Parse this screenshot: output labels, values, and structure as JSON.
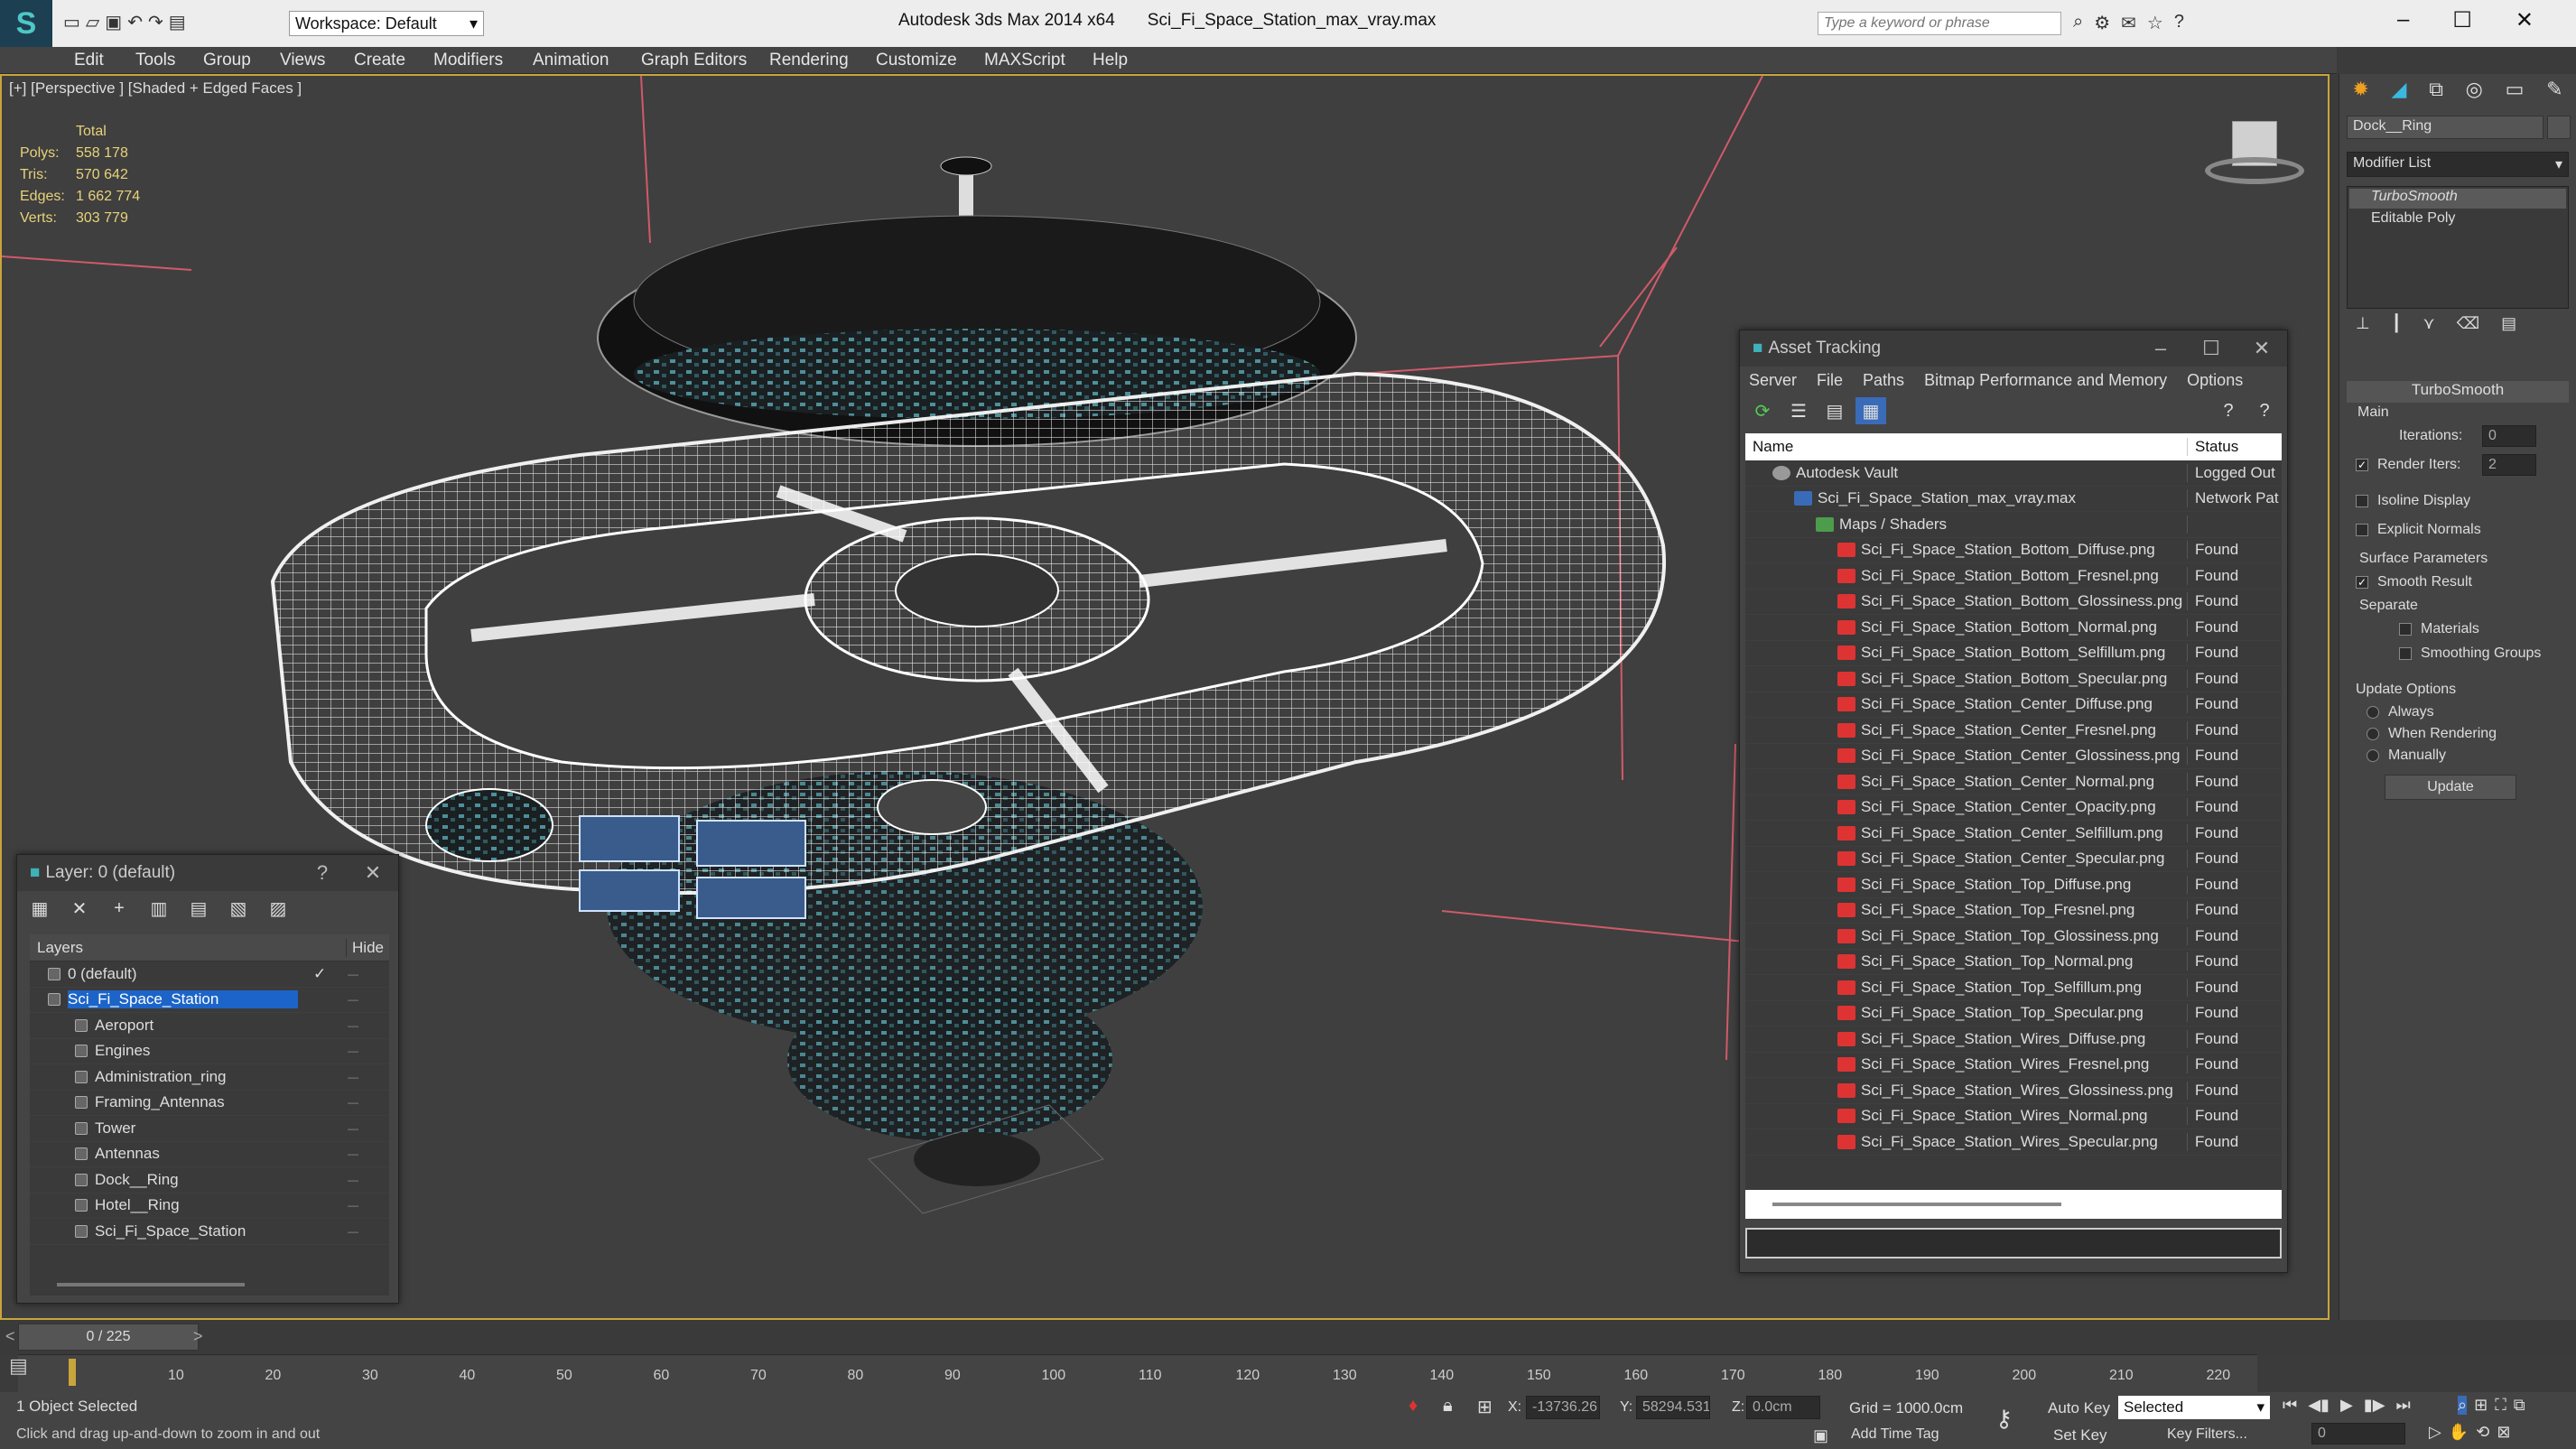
{
  "app": {
    "title": "Autodesk 3ds Max  2014 x64",
    "file": "Sci_Fi_Space_Station_max_vray.max",
    "workspace": "Workspace: Default",
    "search_placeholder": "Type a keyword or phrase"
  },
  "menu": [
    "Edit",
    "Tools",
    "Group",
    "Views",
    "Create",
    "Modifiers",
    "Animation",
    "Graph Editors",
    "Rendering",
    "Customize",
    "MAXScript",
    "Help"
  ],
  "viewport": {
    "label": "[+] [Perspective ] [Shaded + Edged Faces ]",
    "stats": {
      "total_label": "Total",
      "polys_label": "Polys:",
      "polys": "558 178",
      "tris_label": "Tris:",
      "tris": "570 642",
      "edges_label": "Edges:",
      "edges": "1 662 774",
      "verts_label": "Verts:",
      "verts": "303 779"
    }
  },
  "layer_window": {
    "title": "Layer: 0 (default)",
    "help": "?",
    "col_layers": "Layers",
    "col_hide": "Hide",
    "rows": [
      {
        "name": "0 (default)",
        "level": 0
      },
      {
        "name": "Sci_Fi_Space_Station",
        "level": 0,
        "selected": true
      },
      {
        "name": "Aeroport",
        "level": 1
      },
      {
        "name": "Engines",
        "level": 1
      },
      {
        "name": "Administration_ring",
        "level": 1
      },
      {
        "name": "Framing_Antennas",
        "level": 1
      },
      {
        "name": "Tower",
        "level": 1
      },
      {
        "name": "Antennas",
        "level": 1
      },
      {
        "name": "Dock__Ring",
        "level": 1
      },
      {
        "name": "Hotel__Ring",
        "level": 1
      },
      {
        "name": "Sci_Fi_Space_Station",
        "level": 1
      }
    ]
  },
  "asset_tracking": {
    "title": "Asset Tracking",
    "menu": [
      "Server",
      "File",
      "Paths",
      "Bitmap Performance and Memory",
      "Options"
    ],
    "col_name": "Name",
    "col_status": "Status",
    "rows": [
      {
        "name": "Autodesk Vault",
        "status": "Logged Out",
        "level": 0,
        "icon": "vault"
      },
      {
        "name": "Sci_Fi_Space_Station_max_vray.max",
        "status": "Network Pat",
        "level": 1,
        "icon": "max"
      },
      {
        "name": "Maps / Shaders",
        "status": "",
        "level": 2,
        "icon": "folder"
      },
      {
        "name": "Sci_Fi_Space_Station_Bottom_Diffuse.png",
        "status": "Found",
        "level": 3,
        "icon": "png"
      },
      {
        "name": "Sci_Fi_Space_Station_Bottom_Fresnel.png",
        "status": "Found",
        "level": 3,
        "icon": "png"
      },
      {
        "name": "Sci_Fi_Space_Station_Bottom_Glossiness.png",
        "status": "Found",
        "level": 3,
        "icon": "png"
      },
      {
        "name": "Sci_Fi_Space_Station_Bottom_Normal.png",
        "status": "Found",
        "level": 3,
        "icon": "png"
      },
      {
        "name": "Sci_Fi_Space_Station_Bottom_Selfillum.png",
        "status": "Found",
        "level": 3,
        "icon": "png"
      },
      {
        "name": "Sci_Fi_Space_Station_Bottom_Specular.png",
        "status": "Found",
        "level": 3,
        "icon": "png"
      },
      {
        "name": "Sci_Fi_Space_Station_Center_Diffuse.png",
        "status": "Found",
        "level": 3,
        "icon": "png"
      },
      {
        "name": "Sci_Fi_Space_Station_Center_Fresnel.png",
        "status": "Found",
        "level": 3,
        "icon": "png"
      },
      {
        "name": "Sci_Fi_Space_Station_Center_Glossiness.png",
        "status": "Found",
        "level": 3,
        "icon": "png"
      },
      {
        "name": "Sci_Fi_Space_Station_Center_Normal.png",
        "status": "Found",
        "level": 3,
        "icon": "png"
      },
      {
        "name": "Sci_Fi_Space_Station_Center_Opacity.png",
        "status": "Found",
        "level": 3,
        "icon": "png"
      },
      {
        "name": "Sci_Fi_Space_Station_Center_Selfillum.png",
        "status": "Found",
        "level": 3,
        "icon": "png"
      },
      {
        "name": "Sci_Fi_Space_Station_Center_Specular.png",
        "status": "Found",
        "level": 3,
        "icon": "png"
      },
      {
        "name": "Sci_Fi_Space_Station_Top_Diffuse.png",
        "status": "Found",
        "level": 3,
        "icon": "png"
      },
      {
        "name": "Sci_Fi_Space_Station_Top_Fresnel.png",
        "status": "Found",
        "level": 3,
        "icon": "png"
      },
      {
        "name": "Sci_Fi_Space_Station_Top_Glossiness.png",
        "status": "Found",
        "level": 3,
        "icon": "png"
      },
      {
        "name": "Sci_Fi_Space_Station_Top_Normal.png",
        "status": "Found",
        "level": 3,
        "icon": "png"
      },
      {
        "name": "Sci_Fi_Space_Station_Top_Selfillum.png",
        "status": "Found",
        "level": 3,
        "icon": "png"
      },
      {
        "name": "Sci_Fi_Space_Station_Top_Specular.png",
        "status": "Found",
        "level": 3,
        "icon": "png"
      },
      {
        "name": "Sci_Fi_Space_Station_Wires_Diffuse.png",
        "status": "Found",
        "level": 3,
        "icon": "png"
      },
      {
        "name": "Sci_Fi_Space_Station_Wires_Fresnel.png",
        "status": "Found",
        "level": 3,
        "icon": "png"
      },
      {
        "name": "Sci_Fi_Space_Station_Wires_Glossiness.png",
        "status": "Found",
        "level": 3,
        "icon": "png"
      },
      {
        "name": "Sci_Fi_Space_Station_Wires_Normal.png",
        "status": "Found",
        "level": 3,
        "icon": "png"
      },
      {
        "name": "Sci_Fi_Space_Station_Wires_Specular.png",
        "status": "Found",
        "level": 3,
        "icon": "png"
      }
    ]
  },
  "command_panel": {
    "object_name": "Dock__Ring",
    "modifier_list": "Modifier List",
    "stack": [
      "TurboSmooth",
      "Editable Poly"
    ],
    "rollout_title": "TurboSmooth",
    "main_label": "Main",
    "iterations_label": "Iterations:",
    "iterations": "0",
    "render_iters_label": "Render Iters:",
    "render_iters": "2",
    "render_iters_checked": true,
    "isoline_label": "Isoline Display",
    "explicit_normals_label": "Explicit Normals",
    "surface_params_label": "Surface Parameters",
    "smooth_result_label": "Smooth Result",
    "separate_label": "Separate",
    "materials_label": "Materials",
    "smoothing_groups_label": "Smoothing Groups",
    "update_options_label": "Update Options",
    "always_label": "Always",
    "when_rendering_label": "When Rendering",
    "manually_label": "Manually",
    "update_button": "Update"
  },
  "timeline": {
    "frame_label": "0 / 225",
    "ticks": [
      "10",
      "20",
      "30",
      "40",
      "50",
      "60",
      "70",
      "80",
      "90",
      "100",
      "110",
      "120",
      "130",
      "140",
      "150",
      "160",
      "170",
      "180",
      "190",
      "200",
      "210",
      "220"
    ]
  },
  "status": {
    "selection": "1 Object Selected",
    "prompt": "Click and drag up-and-down to zoom in and out",
    "x_label": "X:",
    "x": "-13736.26",
    "y_label": "Y:",
    "y": "58294.531",
    "z_label": "Z:",
    "z": "0.0cm",
    "grid": "Grid = 1000.0cm",
    "auto_key": "Auto Key",
    "set_key": "Set Key",
    "selected": "Selected",
    "key_filters": "Key Filters...",
    "add_time_tag": "Add Time Tag",
    "frame": "0"
  },
  "colors": {
    "accent": "#c8a53c",
    "selection": "#1c64c8",
    "stats": "#e8d27a",
    "png_icon": "#d33"
  }
}
